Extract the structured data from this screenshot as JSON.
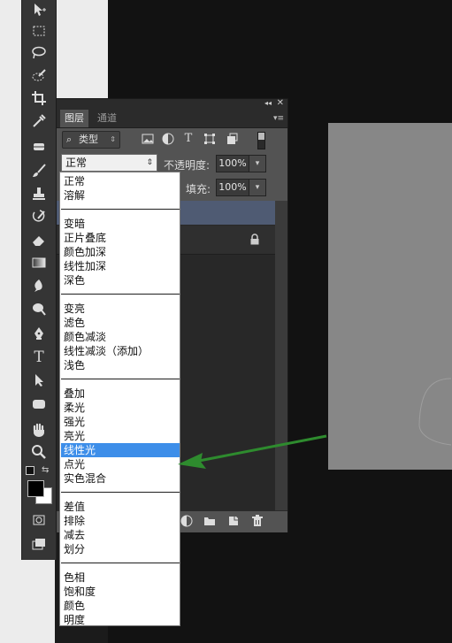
{
  "toolbar": {
    "tools": [
      "move-tool-icon",
      "marquee-tool-icon",
      "lasso-tool-icon",
      "quick-selection-icon",
      "crop-tool-icon",
      "eyedropper-icon",
      "healing-brush-icon",
      "brush-tool-icon",
      "clone-stamp-icon",
      "history-brush-icon",
      "eraser-icon",
      "gradient-tool-icon",
      "blur-tool-icon",
      "dodge-tool-icon",
      "pen-tool-icon",
      "type-tool-icon",
      "path-selection-icon",
      "rectangle-tool-icon",
      "hand-tool-icon",
      "zoom-tool-icon",
      "color-swatch-icon",
      "quick-mask-icon",
      "screen-mode-icon"
    ],
    "type_glyph": "T"
  },
  "panel": {
    "tabs": [
      "图层",
      "通道"
    ],
    "filter_label": "类型",
    "blend_mode": "正常",
    "opacity_label": "不透明度:",
    "opacity_value": "100%",
    "fill_label": "填充:",
    "fill_value": "100%",
    "filter_text_glyph": "T"
  },
  "dropdown": {
    "groups": [
      [
        "正常",
        "溶解"
      ],
      [
        "变暗",
        "正片叠底",
        "颜色加深",
        "线性加深",
        "深色"
      ],
      [
        "变亮",
        "滤色",
        "颜色减淡",
        "线性减淡（添加）",
        "浅色"
      ],
      [
        "叠加",
        "柔光",
        "强光",
        "亮光",
        "线性光",
        "点光",
        "实色混合"
      ],
      [
        "差值",
        "排除",
        "减去",
        "划分"
      ],
      [
        "色相",
        "饱和度",
        "颜色",
        "明度"
      ]
    ],
    "selected": "线性光"
  },
  "colors": {
    "selection": "#3d8ee9",
    "arrow": "#2e8b2e",
    "panel_bg": "#535353"
  }
}
